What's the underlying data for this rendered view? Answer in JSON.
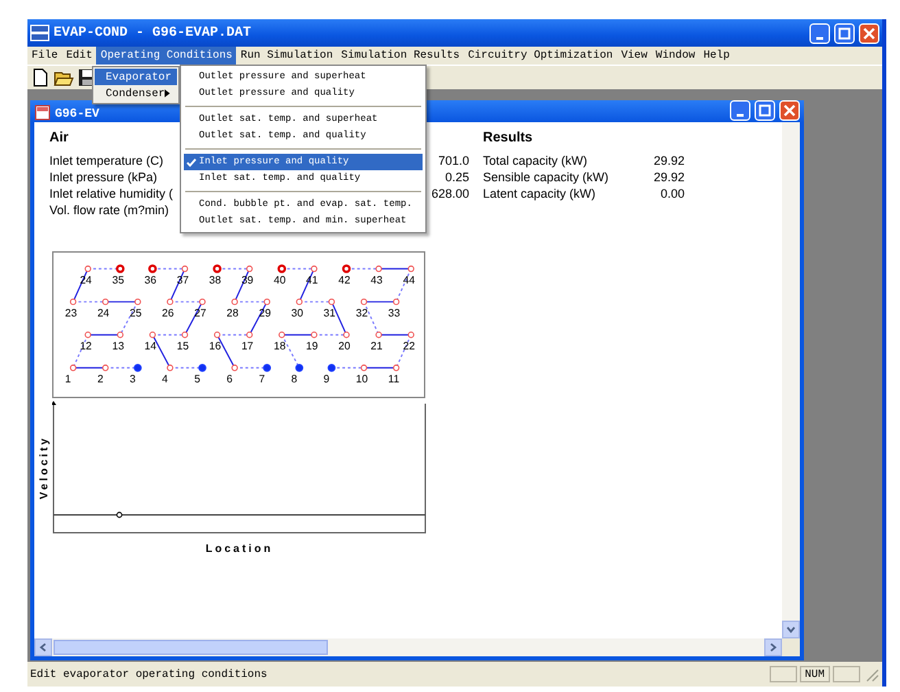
{
  "window": {
    "title": "EVAP-COND  -  G96-EVAP.DAT"
  },
  "menubar": {
    "items": [
      {
        "label": "File",
        "selected": false
      },
      {
        "label": "Edit",
        "selected": false
      },
      {
        "label": "Operating Conditions",
        "selected": true
      },
      {
        "label": "Run Simulation",
        "selected": false
      },
      {
        "label": "Simulation Results",
        "selected": false
      },
      {
        "label": "Circuitry Optimization",
        "selected": false
      },
      {
        "label": "View",
        "selected": false
      },
      {
        "label": "Window",
        "selected": false
      },
      {
        "label": "Help",
        "selected": false
      }
    ]
  },
  "dropdown": {
    "items": [
      {
        "label": "Evaporator",
        "selected": true
      },
      {
        "label": "Condenser",
        "selected": false
      }
    ]
  },
  "submenu": {
    "groups": [
      [
        {
          "label": "Outlet pressure and superheat",
          "checked": false,
          "selected": false
        },
        {
          "label": "Outlet pressure and quality",
          "checked": false,
          "selected": false
        }
      ],
      [
        {
          "label": "Outlet sat. temp.  and superheat",
          "checked": false,
          "selected": false
        },
        {
          "label": "Outlet sat. temp.  and quality",
          "checked": false,
          "selected": false
        }
      ],
      [
        {
          "label": "Inlet pressure and quality",
          "checked": true,
          "selected": true
        },
        {
          "label": "Inlet sat. temp.  and quality",
          "checked": false,
          "selected": false
        }
      ],
      [
        {
          "label": "Cond. bubble pt.  and evap. sat. temp.",
          "checked": false,
          "selected": false
        },
        {
          "label": "Outlet sat. temp. and min. superheat",
          "checked": false,
          "selected": false
        }
      ]
    ]
  },
  "child_window": {
    "title": "G96-EV"
  },
  "air": {
    "heading": "Air",
    "rows": [
      {
        "label": "Inlet temperature (C)",
        "value": "701.0"
      },
      {
        "label": "Inlet pressure (kPa)",
        "value": "0.25"
      },
      {
        "label": "Inlet relative humidity (",
        "value": "628.00"
      },
      {
        "label": "Vol. flow rate (m?min)"
      }
    ]
  },
  "results": {
    "heading": "Results",
    "rows": [
      {
        "label": "Total capacity (kW)",
        "value": "29.92"
      },
      {
        "label": "Sensible capacity (kW)",
        "value": "29.92"
      },
      {
        "label": "Latent capacity (kW)",
        "value": "0.00"
      }
    ]
  },
  "circuit": {
    "rows": [
      [
        {
          "label": "24",
          "kind": "open",
          "right": {
            "kind": "dashed"
          },
          "down_left": {
            "kind": "solid"
          }
        },
        {
          "label": "35",
          "kind": "inlet"
        },
        {
          "label": "36",
          "kind": "inlet",
          "right": {
            "kind": "dashed"
          }
        },
        {
          "label": "37",
          "kind": "open",
          "down_left": {
            "kind": "solid"
          }
        },
        {
          "label": "38",
          "kind": "inlet",
          "right": {
            "kind": "dashed"
          }
        },
        {
          "label": "39",
          "kind": "open",
          "down_left": {
            "kind": "solid"
          }
        },
        {
          "label": "40",
          "kind": "inlet",
          "right": {
            "kind": "dashed"
          }
        },
        {
          "label": "41",
          "kind": "open",
          "down_left": {
            "kind": "solid"
          }
        },
        {
          "label": "42",
          "kind": "inlet",
          "right": {
            "kind": "dashed"
          }
        },
        {
          "label": "43",
          "kind": "open",
          "right": {
            "kind": "solid"
          }
        },
        {
          "label": "44",
          "kind": "open",
          "down_left": {
            "kind": "dashed"
          }
        }
      ],
      [
        {
          "label": "23",
          "kind": "open",
          "right": {
            "kind": "dashed"
          }
        },
        {
          "label": "24",
          "kind": "open",
          "right": {
            "kind": "solid"
          }
        },
        {
          "label": "25",
          "kind": "open",
          "down_left": {
            "kind": "dashed"
          }
        },
        {
          "label": "26",
          "kind": "open",
          "right": {
            "kind": "dashed"
          }
        },
        {
          "label": "27",
          "kind": "open",
          "down_left": {
            "kind": "solid"
          }
        },
        {
          "label": "28",
          "kind": "open",
          "right": {
            "kind": "dashed"
          }
        },
        {
          "label": "29",
          "kind": "open",
          "down_left": {
            "kind": "solid"
          }
        },
        {
          "label": "30",
          "kind": "open",
          "right": {
            "kind": "dashed"
          }
        },
        {
          "label": "31",
          "kind": "open",
          "down_right": {
            "kind": "solid"
          }
        },
        {
          "label": "32",
          "kind": "open",
          "right": {
            "kind": "solid"
          },
          "down_right": {
            "kind": "dashed"
          }
        },
        {
          "label": "33",
          "kind": "open"
        }
      ],
      [
        {
          "label": "12",
          "kind": "open",
          "right": {
            "kind": "solid"
          },
          "down_left": {
            "kind": "dashed"
          }
        },
        {
          "label": "13",
          "kind": "open"
        },
        {
          "label": "14",
          "kind": "open",
          "right": {
            "kind": "dashed"
          },
          "down_right": {
            "kind": "solid"
          }
        },
        {
          "label": "15",
          "kind": "open"
        },
        {
          "label": "16",
          "kind": "open",
          "right": {
            "kind": "dashed"
          },
          "down_right": {
            "kind": "solid"
          }
        },
        {
          "label": "17",
          "kind": "open"
        },
        {
          "label": "18",
          "kind": "open",
          "right": {
            "kind": "solid"
          },
          "down_right": {
            "kind": "dashed"
          }
        },
        {
          "label": "19",
          "kind": "open",
          "right": {
            "kind": "dashed"
          }
        },
        {
          "label": "20",
          "kind": "open"
        },
        {
          "label": "21",
          "kind": "open",
          "right": {
            "kind": "solid"
          }
        },
        {
          "label": "22",
          "kind": "open",
          "down_left": {
            "kind": "dashed"
          }
        }
      ],
      [
        {
          "label": "1",
          "kind": "open",
          "right": {
            "kind": "solid"
          }
        },
        {
          "label": "2",
          "kind": "open",
          "right": {
            "kind": "dashed"
          }
        },
        {
          "label": "3",
          "kind": "outlet"
        },
        {
          "label": "4",
          "kind": "open",
          "right": {
            "kind": "dashed"
          }
        },
        {
          "label": "5",
          "kind": "outlet"
        },
        {
          "label": "6",
          "kind": "open",
          "right": {
            "kind": "dashed"
          }
        },
        {
          "label": "7",
          "kind": "outlet"
        },
        {
          "label": "8",
          "kind": "outlet"
        },
        {
          "label": "9",
          "kind": "outlet",
          "right": {
            "kind": "dashed"
          }
        },
        {
          "label": "10",
          "kind": "open",
          "right": {
            "kind": "solid"
          }
        },
        {
          "label": "11",
          "kind": "open"
        }
      ]
    ]
  },
  "plot": {
    "ylabel": "Velocity",
    "xlabel": "Location"
  },
  "status_bar": {
    "message": "Edit evaporator operating conditions",
    "indicator": "NUM"
  }
}
